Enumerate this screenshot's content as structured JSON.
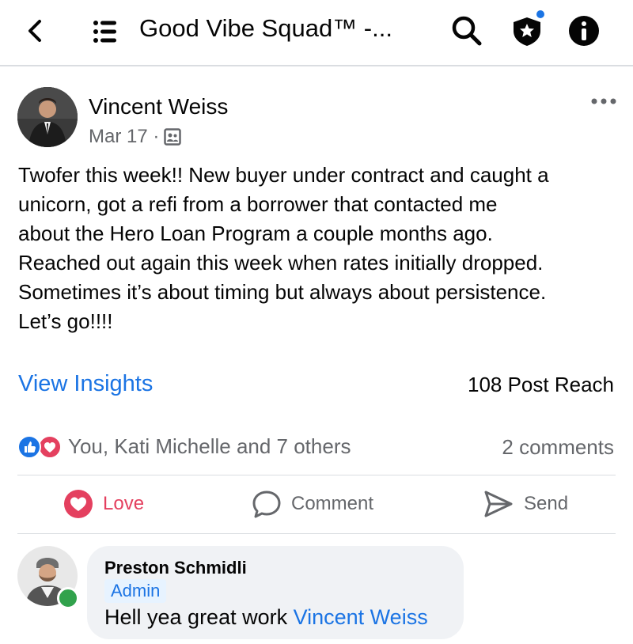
{
  "header": {
    "title": "Good Vibe Squad™ -...",
    "icons": [
      "back-arrow-icon",
      "menu-icon",
      "search-icon",
      "shield-star-icon",
      "info-icon"
    ],
    "accent_color": "#1b74e4"
  },
  "post": {
    "author": "Vincent Weiss",
    "date": "Mar 17 ·",
    "privacy_icon": "members-icon",
    "text_lines": [
      "Twofer this week!! New buyer under contract and caught a",
      "unicorn, got a refi from a borrower that contacted me",
      "about the Hero Loan Program a couple months ago.",
      "Reached out again this week when rates initially dropped.",
      "Sometimes it’s about timing but always about persistence.",
      "Let’s go!!!!"
    ],
    "insights_label": "View Insights",
    "reach": "108 Post Reach",
    "reactions": "You, Kati Michelle and 7 others",
    "comments_count": "2 comments"
  },
  "actions": {
    "love": "Love",
    "comment": "Comment",
    "send": "Send",
    "love_color": "#e4405f"
  },
  "comment": {
    "author": "Preston Schmidli",
    "badge": "Admin",
    "text": "Hell yea great work ",
    "mention": "Vincent Weiss",
    "online_color": "#31a24c"
  }
}
